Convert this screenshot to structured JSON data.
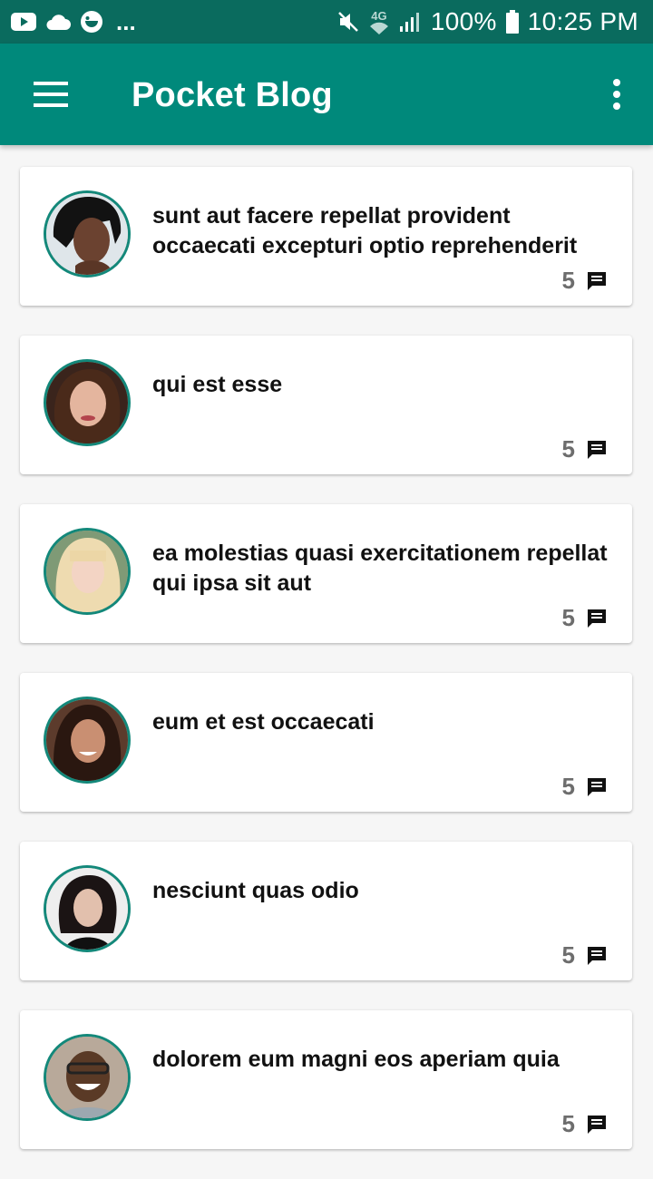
{
  "status_bar": {
    "network": "4G",
    "battery": "100%",
    "time": "10:25 PM"
  },
  "app_bar": {
    "title": "Pocket Blog",
    "icons": {
      "menu": "hamburger-menu-icon",
      "overflow": "more-vert-icon"
    }
  },
  "posts": [
    {
      "title": "sunt aut facere repellat provident occaecati excepturi optio reprehenderit",
      "comments": "5"
    },
    {
      "title": "qui est esse",
      "comments": "5"
    },
    {
      "title": "ea molestias quasi exercitationem repellat qui ipsa sit aut",
      "comments": "5"
    },
    {
      "title": "eum et est occaecati",
      "comments": "5"
    },
    {
      "title": "nesciunt quas odio",
      "comments": "5"
    },
    {
      "title": "dolorem eum magni eos aperiam quia",
      "comments": "5"
    }
  ],
  "colors": {
    "status_bar": "#0a6b5e",
    "primary": "#00897b",
    "avatar_ring": "#13887a",
    "background": "#f6f6f6"
  }
}
